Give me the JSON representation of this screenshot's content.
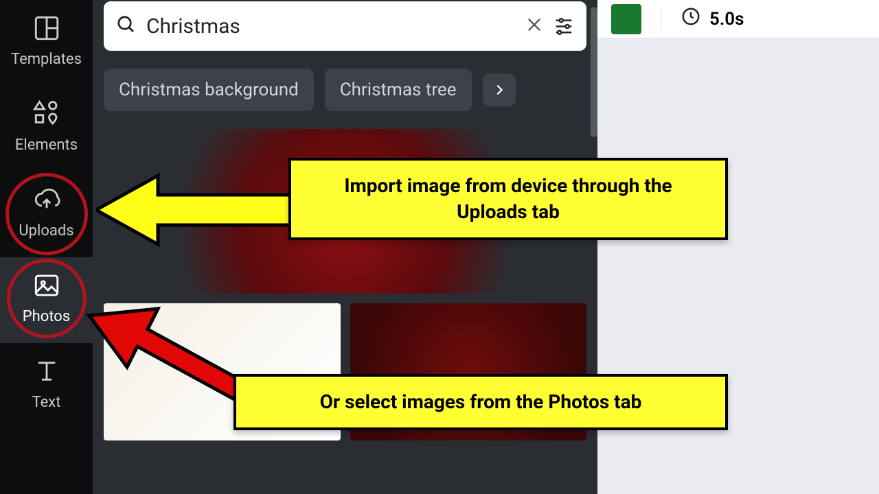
{
  "sidebar": {
    "items": [
      {
        "label": "Templates",
        "icon": "templates-icon"
      },
      {
        "label": "Elements",
        "icon": "elements-icon"
      },
      {
        "label": "Uploads",
        "icon": "uploads-icon"
      },
      {
        "label": "Photos",
        "icon": "photos-icon"
      },
      {
        "label": "Text",
        "icon": "text-icon"
      }
    ]
  },
  "search": {
    "value": "Christmas"
  },
  "chips": [
    "Christmas background",
    "Christmas tree"
  ],
  "canvas": {
    "swatch_color": "#197a2e",
    "duration": "5.0s"
  },
  "annotations": {
    "callout1": "Import image from device through the Uploads tab",
    "callout2": "Or select images from the Photos tab"
  }
}
